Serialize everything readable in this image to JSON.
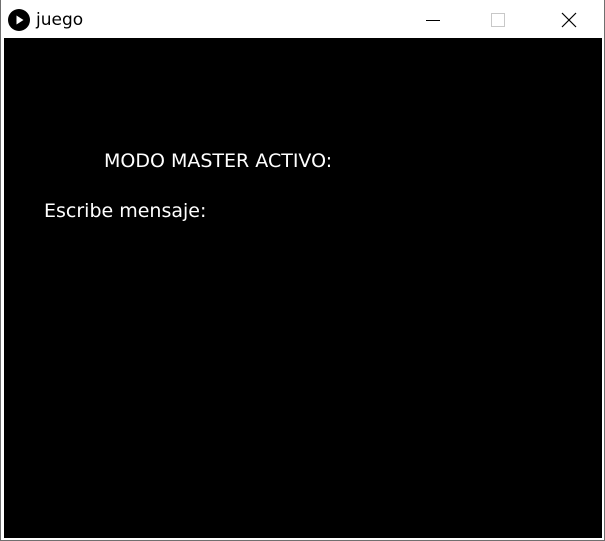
{
  "window": {
    "title": "juego",
    "icon": "processing-play-icon",
    "controls": {
      "minimize": "minimize-icon",
      "maximize": "maximize-icon",
      "close": "close-icon"
    }
  },
  "canvas": {
    "background": "#000000",
    "text_color": "#ffffff",
    "lines": {
      "mode": "MODO MASTER ACTIVO:",
      "prompt": "Escribe mensaje:"
    }
  }
}
